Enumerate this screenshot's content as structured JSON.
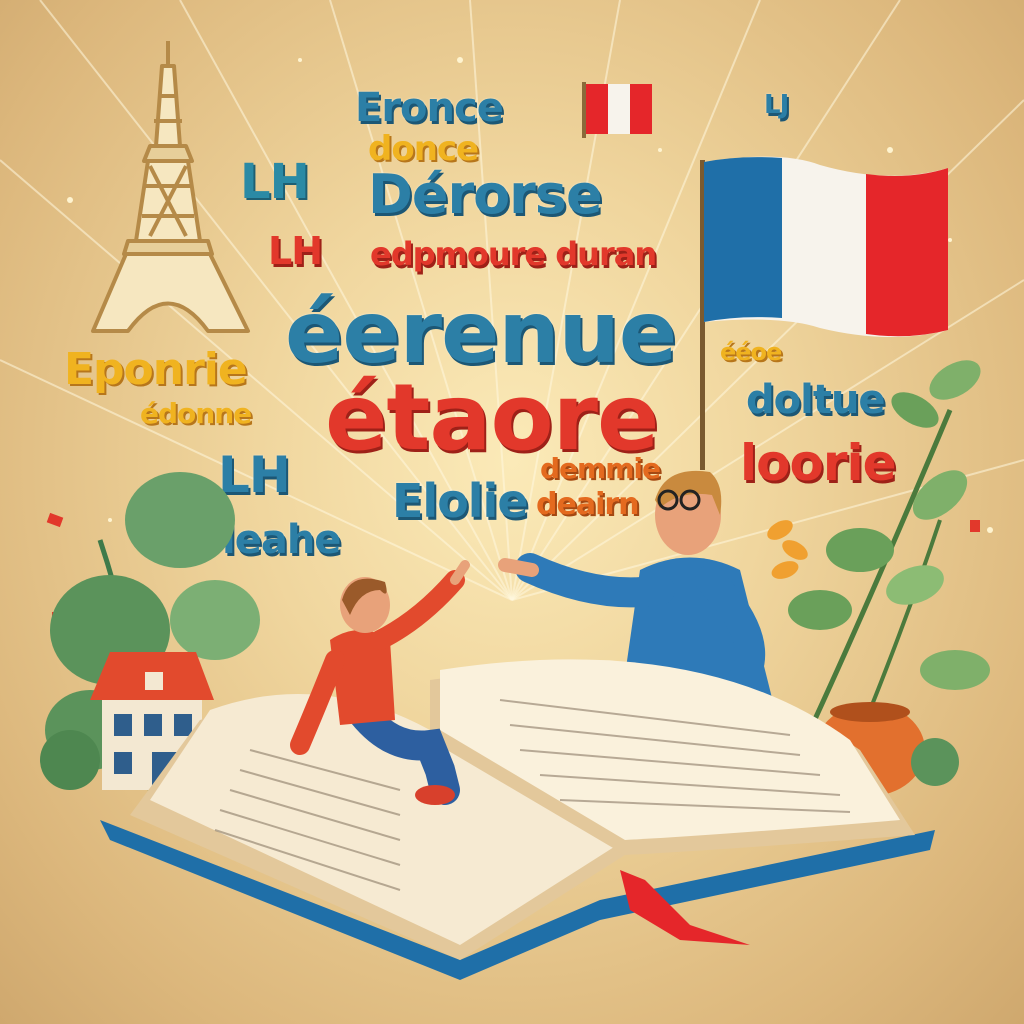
{
  "scene": {
    "words": [
      {
        "key": "w1",
        "text": "Eronce"
      },
      {
        "key": "w2",
        "text": "donce"
      },
      {
        "key": "w3",
        "text": "LH"
      },
      {
        "key": "w4",
        "text": "Dérorse"
      },
      {
        "key": "w5",
        "text": "LH"
      },
      {
        "key": "w6",
        "text": "edpmoure duran"
      },
      {
        "key": "w7",
        "text": "Eponrie"
      },
      {
        "key": "w8",
        "text": "éerenue"
      },
      {
        "key": "w9",
        "text": "édonne"
      },
      {
        "key": "w10",
        "text": "étaore"
      },
      {
        "key": "w11",
        "text": "ééoe"
      },
      {
        "key": "w12",
        "text": "doltue"
      },
      {
        "key": "w13",
        "text": "loorie"
      },
      {
        "key": "w14",
        "text": "LH"
      },
      {
        "key": "w15",
        "text": "demmie"
      },
      {
        "key": "w16",
        "text": "Elolie"
      },
      {
        "key": "w17",
        "text": "deairn"
      },
      {
        "key": "w18",
        "text": "leahe"
      },
      {
        "key": "w19",
        "text": "LJ"
      }
    ],
    "colors": {
      "flag_blue": "#1f6fa8",
      "flag_white": "#f7f3ec",
      "flag_red": "#e5262a",
      "book_cover": "#1f6fa8",
      "ribbon": "#e5262a"
    },
    "icons": [
      "eiffel-tower-icon",
      "french-flag-icon",
      "small-flag-icon",
      "house-icon",
      "open-book-icon",
      "child-figure",
      "adult-figure",
      "plant-icon",
      "pot-icon"
    ]
  }
}
